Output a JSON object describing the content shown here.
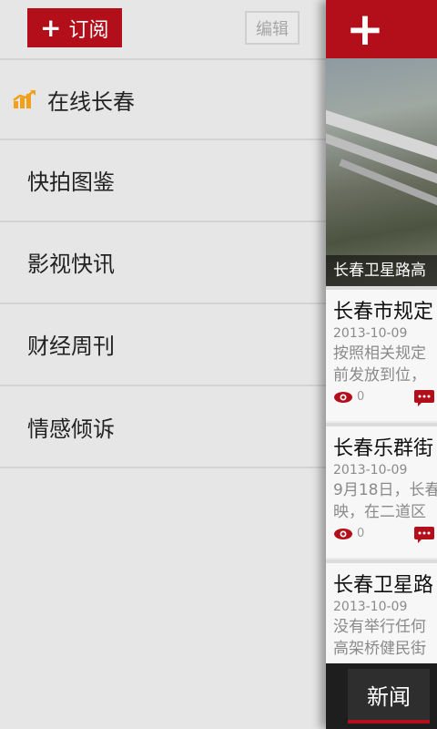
{
  "drawer": {
    "subscribe_label": "订阅",
    "edit_label": "编辑",
    "items": [
      {
        "label": "在线长春",
        "icon": "chart-icon"
      },
      {
        "label": "快拍图鉴"
      },
      {
        "label": "影视快讯"
      },
      {
        "label": "财经周刊"
      },
      {
        "label": "情感倾诉"
      }
    ]
  },
  "content": {
    "hero_caption": "长春卫星路高",
    "articles": [
      {
        "title": "长春市规定",
        "date": "2013-10-09",
        "summary_lines": [
          "按照相关规定",
          "前发放到位，"
        ],
        "views": "0"
      },
      {
        "title": "长春乐群街",
        "date": "2013-10-09",
        "summary_lines": [
          "9月18日，长春",
          "映，在二道区"
        ],
        "views": "0"
      },
      {
        "title": "长春卫星路",
        "date": "2013-10-09",
        "summary_lines": [
          "没有举行任何",
          "高架桥健民街"
        ],
        "views": ""
      }
    ],
    "bottom_tab_label": "新闻"
  },
  "colors": {
    "accent": "#b20f1b",
    "drawer_bg": "#e6e6e6",
    "icon_orange": "#f2a019"
  }
}
